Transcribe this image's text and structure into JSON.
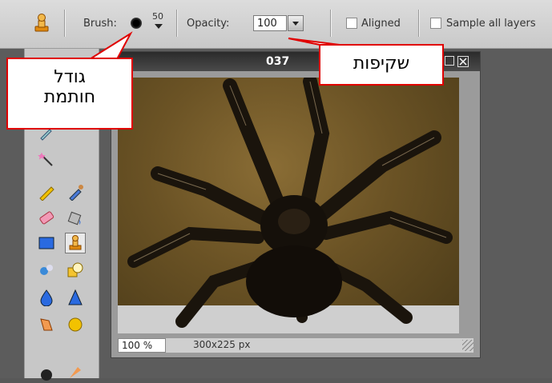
{
  "toolbar": {
    "brush_label": "Brush:",
    "brush_size": "50",
    "opacity_label": "Opacity:",
    "opacity_value": "100",
    "aligned_label": "Aligned",
    "sample_all_layers_label": "Sample all layers"
  },
  "image_window": {
    "title": "037",
    "zoom": "100 %",
    "dimensions": "300x225 px"
  },
  "callouts": {
    "stamp_size": [
      "גודל",
      "חותמת"
    ],
    "opacity": "שקיפות"
  },
  "colors": {
    "callout_border": "#e00000",
    "toolbar_bg": "#d4d4d4",
    "workspace_bg": "#5c5c5c"
  }
}
